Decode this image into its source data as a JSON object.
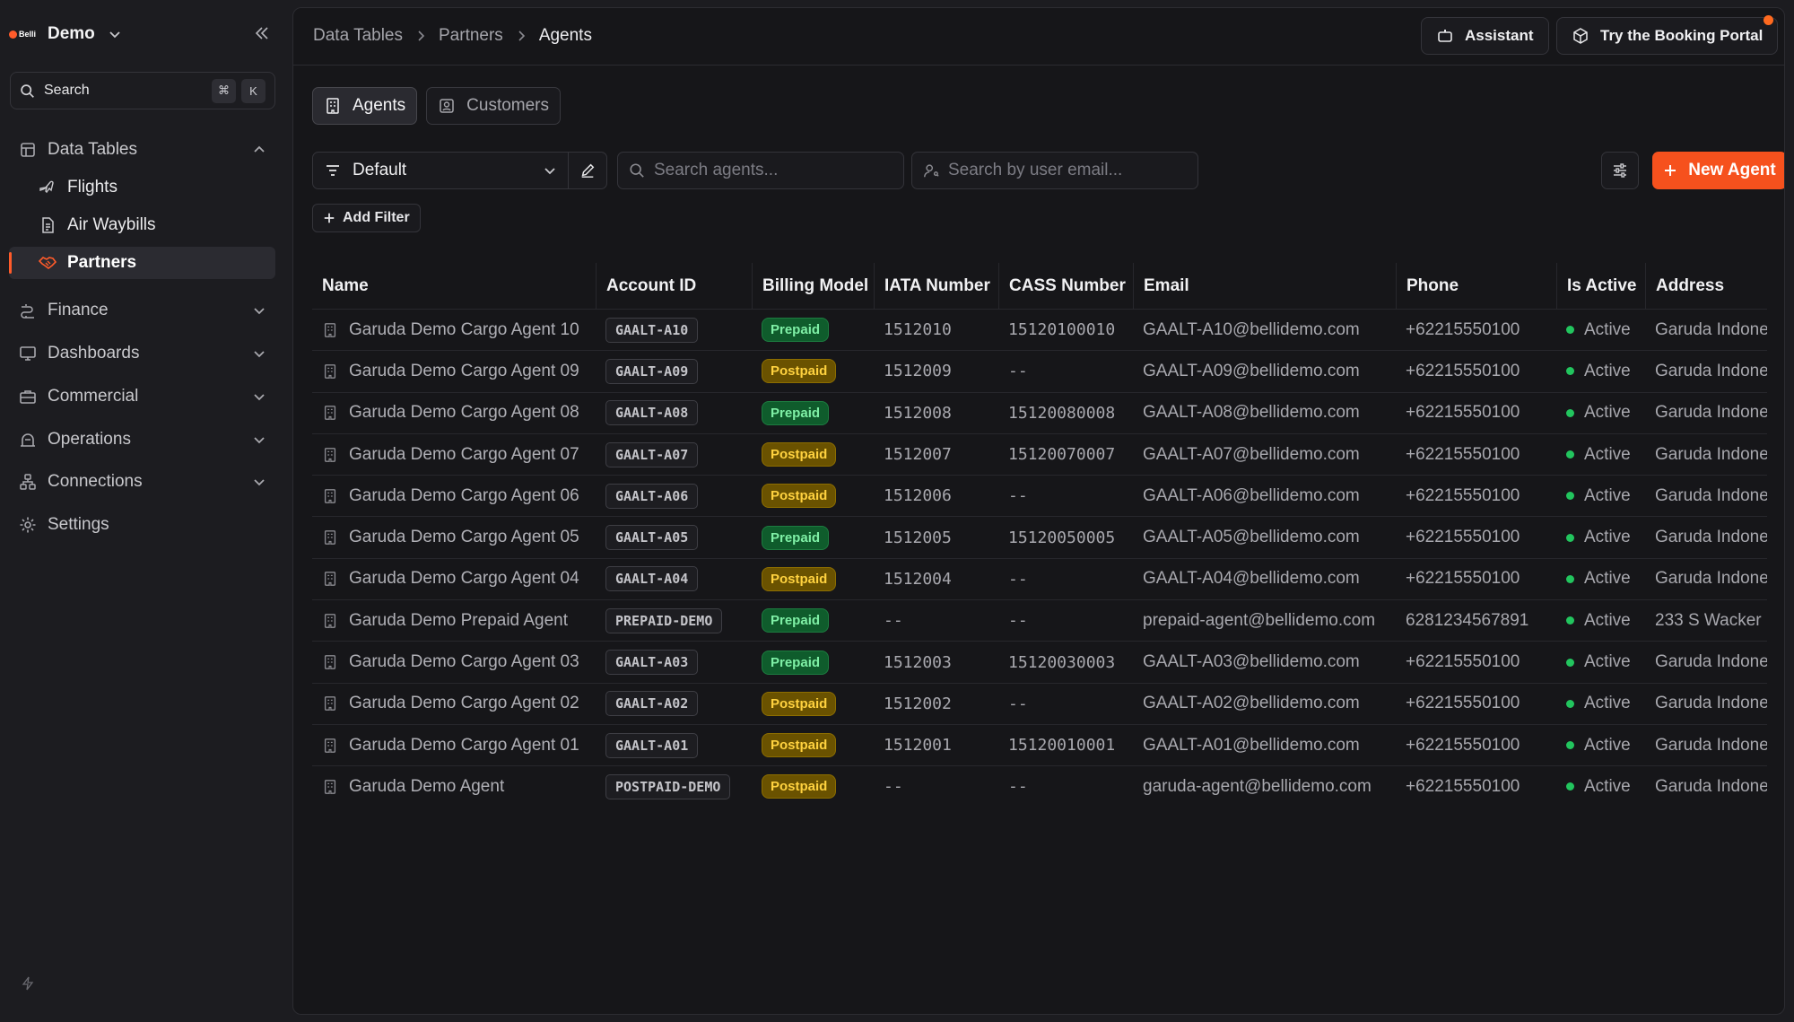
{
  "app": {
    "logo_text": "Belli",
    "workspace": "Demo",
    "search": {
      "label": "Search",
      "kbd1": "⌘",
      "kbd2": "K"
    }
  },
  "sidebar": {
    "sections": [
      {
        "label": "Data Tables",
        "icon": "table-icon",
        "expanded": true
      },
      {
        "label": "Finance",
        "icon": "finance-icon"
      },
      {
        "label": "Dashboards",
        "icon": "monitor-icon"
      },
      {
        "label": "Commercial",
        "icon": "briefcase-icon"
      },
      {
        "label": "Operations",
        "icon": "operations-icon"
      },
      {
        "label": "Connections",
        "icon": "connections-icon"
      },
      {
        "label": "Settings",
        "icon": "gear-icon"
      }
    ],
    "sub_items": [
      {
        "label": "Flights",
        "icon": "plane-icon"
      },
      {
        "label": "Air Waybills",
        "icon": "document-icon"
      },
      {
        "label": "Partners",
        "icon": "handshake-icon",
        "active": true
      }
    ]
  },
  "breadcrumb": [
    "Data Tables",
    "Partners",
    "Agents"
  ],
  "header_buttons": {
    "assistant": "Assistant",
    "booking_portal": "Try the Booking Portal"
  },
  "tabs": [
    {
      "label": "Agents",
      "active": true
    },
    {
      "label": "Customers",
      "active": false
    }
  ],
  "toolbar": {
    "view": "Default",
    "search_agents_placeholder": "Search agents...",
    "search_email_placeholder": "Search by user email...",
    "new_agent": "New Agent",
    "add_filter": "Add Filter"
  },
  "table": {
    "columns": [
      "Name",
      "Account ID",
      "Billing Model",
      "IATA Number",
      "CASS Number",
      "Email",
      "Phone",
      "Is Active",
      "Address"
    ],
    "rows": [
      {
        "name": "Garuda Demo Cargo Agent 10",
        "account": "GAALT-A10",
        "billing": "Prepaid",
        "iata": "1512010",
        "cass": "15120100010",
        "email": "GAALT-A10@bellidemo.com",
        "phone": "+62215550100",
        "active": "Active",
        "address": "Garuda Indone"
      },
      {
        "name": "Garuda Demo Cargo Agent 09",
        "account": "GAALT-A09",
        "billing": "Postpaid",
        "iata": "1512009",
        "cass": "--",
        "email": "GAALT-A09@bellidemo.com",
        "phone": "+62215550100",
        "active": "Active",
        "address": "Garuda Indone"
      },
      {
        "name": "Garuda Demo Cargo Agent 08",
        "account": "GAALT-A08",
        "billing": "Prepaid",
        "iata": "1512008",
        "cass": "15120080008",
        "email": "GAALT-A08@bellidemo.com",
        "phone": "+62215550100",
        "active": "Active",
        "address": "Garuda Indone"
      },
      {
        "name": "Garuda Demo Cargo Agent 07",
        "account": "GAALT-A07",
        "billing": "Postpaid",
        "iata": "1512007",
        "cass": "15120070007",
        "email": "GAALT-A07@bellidemo.com",
        "phone": "+62215550100",
        "active": "Active",
        "address": "Garuda Indone"
      },
      {
        "name": "Garuda Demo Cargo Agent 06",
        "account": "GAALT-A06",
        "billing": "Postpaid",
        "iata": "1512006",
        "cass": "--",
        "email": "GAALT-A06@bellidemo.com",
        "phone": "+62215550100",
        "active": "Active",
        "address": "Garuda Indone"
      },
      {
        "name": "Garuda Demo Cargo Agent 05",
        "account": "GAALT-A05",
        "billing": "Prepaid",
        "iata": "1512005",
        "cass": "15120050005",
        "email": "GAALT-A05@bellidemo.com",
        "phone": "+62215550100",
        "active": "Active",
        "address": "Garuda Indone"
      },
      {
        "name": "Garuda Demo Cargo Agent 04",
        "account": "GAALT-A04",
        "billing": "Postpaid",
        "iata": "1512004",
        "cass": "--",
        "email": "GAALT-A04@bellidemo.com",
        "phone": "+62215550100",
        "active": "Active",
        "address": "Garuda Indone"
      },
      {
        "name": "Garuda Demo Prepaid Agent",
        "account": "PREPAID-DEMO",
        "billing": "Prepaid",
        "iata": "--",
        "cass": "--",
        "email": "prepaid-agent@bellidemo.com",
        "phone": "6281234567891",
        "active": "Active",
        "address": "233 S Wacker"
      },
      {
        "name": "Garuda Demo Cargo Agent 03",
        "account": "GAALT-A03",
        "billing": "Prepaid",
        "iata": "1512003",
        "cass": "15120030003",
        "email": "GAALT-A03@bellidemo.com",
        "phone": "+62215550100",
        "active": "Active",
        "address": "Garuda Indone"
      },
      {
        "name": "Garuda Demo Cargo Agent 02",
        "account": "GAALT-A02",
        "billing": "Postpaid",
        "iata": "1512002",
        "cass": "--",
        "email": "GAALT-A02@bellidemo.com",
        "phone": "+62215550100",
        "active": "Active",
        "address": "Garuda Indone"
      },
      {
        "name": "Garuda Demo Cargo Agent 01",
        "account": "GAALT-A01",
        "billing": "Postpaid",
        "iata": "1512001",
        "cass": "15120010001",
        "email": "GAALT-A01@bellidemo.com",
        "phone": "+62215550100",
        "active": "Active",
        "address": "Garuda Indone"
      },
      {
        "name": "Garuda Demo Agent",
        "account": "POSTPAID-DEMO",
        "billing": "Postpaid",
        "iata": "--",
        "cass": "--",
        "email": "garuda-agent@bellidemo.com",
        "phone": "+62215550100",
        "active": "Active",
        "address": "Garuda Indone"
      }
    ]
  },
  "colors": {
    "accent": "#f6511d",
    "prepaid": "#7ff0a6",
    "postpaid": "#ffd23f",
    "active_dot": "#22c55e"
  }
}
